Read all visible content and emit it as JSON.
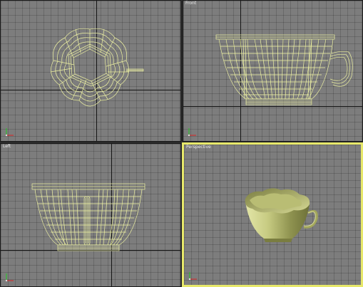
{
  "viewports": [
    {
      "id": "top",
      "label": "",
      "active": false
    },
    {
      "id": "front",
      "label": "Front",
      "active": false
    },
    {
      "id": "left",
      "label": "Left",
      "active": false
    },
    {
      "id": "perspective",
      "label": "Perspective",
      "active": true
    }
  ],
  "colors": {
    "background": "#7d7d7d",
    "grid_axis": "#151515",
    "wireframe": "#eef2a2",
    "active_border": "#e7e86a",
    "shaded_model": "#c9cd86"
  },
  "icons": [
    "axis-tripod-icon"
  ]
}
